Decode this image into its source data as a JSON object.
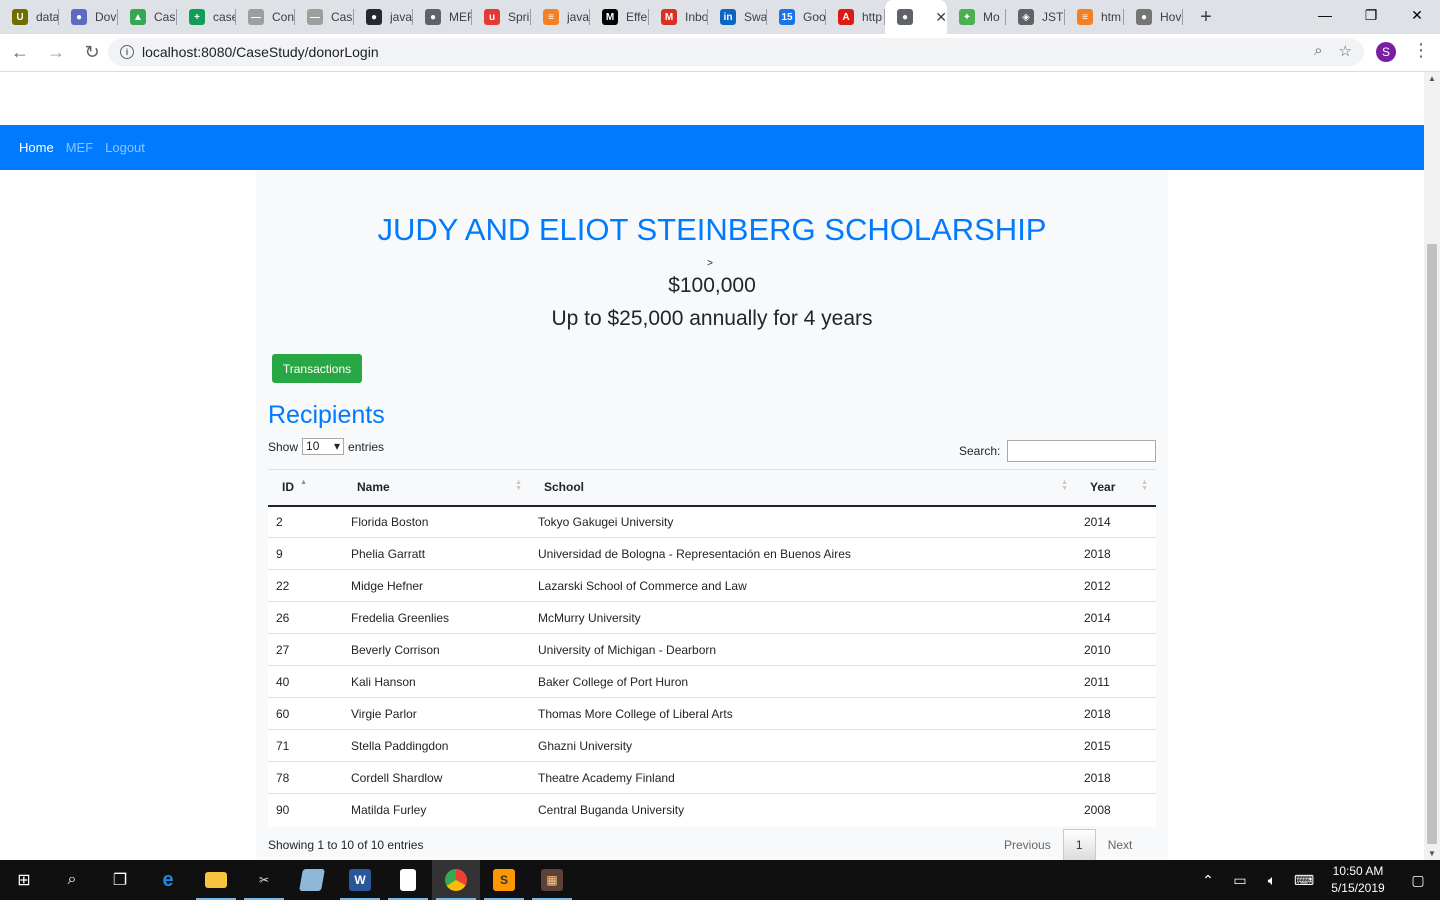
{
  "browser": {
    "tabs": [
      {
        "title": "data",
        "color": "#6d6d00",
        "glyph": "U"
      },
      {
        "title": "Dov",
        "color": "#5c6bc0",
        "glyph": "●"
      },
      {
        "title": "Cas",
        "color": "#34a853",
        "glyph": "▲"
      },
      {
        "title": "case",
        "color": "#0f9d58",
        "glyph": "+"
      },
      {
        "title": "Con",
        "color": "#9e9e9e",
        "glyph": "—"
      },
      {
        "title": "Cas",
        "color": "#9e9e9e",
        "glyph": "—"
      },
      {
        "title": "java",
        "color": "#24292e",
        "glyph": "●"
      },
      {
        "title": "MEF",
        "color": "#5f6368",
        "glyph": "●"
      },
      {
        "title": "Spri",
        "color": "#e53935",
        "glyph": "u"
      },
      {
        "title": "java",
        "color": "#f48024",
        "glyph": "≡"
      },
      {
        "title": "Effe",
        "color": "#000000",
        "glyph": "M"
      },
      {
        "title": "Inbo",
        "color": "#d93025",
        "glyph": "M"
      },
      {
        "title": "Swa",
        "color": "#0a66c2",
        "glyph": "in"
      },
      {
        "title": "Goo",
        "color": "#1a73e8",
        "glyph": "15"
      },
      {
        "title": "http",
        "color": "#dd1b16",
        "glyph": "A"
      }
    ],
    "active_tab": {
      "title": "",
      "color": "#5f6368",
      "glyph": "●"
    },
    "tabs_after": [
      {
        "title": "Mo",
        "color": "#4caf50",
        "glyph": "✦"
      },
      {
        "title": "JSTL",
        "color": "#5f6368",
        "glyph": "◈"
      },
      {
        "title": "htm",
        "color": "#f48024",
        "glyph": "≡"
      },
      {
        "title": "Hov",
        "color": "#757575",
        "glyph": "●"
      }
    ],
    "url": "localhost:8080/CaseStudy/donorLogin",
    "profile_initial": "S"
  },
  "navbar": {
    "home": "Home",
    "mef": "MEF",
    "logout": "Logout"
  },
  "page": {
    "title": "JUDY AND ELIOT STEINBERG SCHOLARSHIP",
    "caret": ">",
    "amount": "$100,000",
    "subtitle": "Up to $25,000 annually for 4 years",
    "transactions_button": "Transactions",
    "section_title": "Recipients",
    "show_label": "Show",
    "show_value": "10",
    "entries_label": "entries",
    "search_label": "Search:",
    "search_value": ""
  },
  "table": {
    "columns": [
      "ID",
      "Name",
      "School",
      "Year"
    ],
    "rows": [
      [
        "2",
        "Florida Boston",
        "Tokyo Gakugei University",
        "2014"
      ],
      [
        "9",
        "Phelia Garratt",
        "Universidad de Bologna - Representación en Buenos Aires",
        "2018"
      ],
      [
        "22",
        "Midge Hefner",
        "Lazarski School of Commerce and Law",
        "2012"
      ],
      [
        "26",
        "Fredelia Greenlies",
        "McMurry University",
        "2014"
      ],
      [
        "27",
        "Beverly Corrison",
        "University of Michigan - Dearborn",
        "2010"
      ],
      [
        "40",
        "Kali Hanson",
        "Baker College of Port Huron",
        "2011"
      ],
      [
        "60",
        "Virgie Parlor",
        "Thomas More College of Liberal Arts",
        "2018"
      ],
      [
        "71",
        "Stella Paddingdon",
        "Ghazni University",
        "2015"
      ],
      [
        "78",
        "Cordell Shardlow",
        "Theatre Academy Finland",
        "2018"
      ],
      [
        "90",
        "Matilda Furley",
        "Central Buganda University",
        "2008"
      ]
    ]
  },
  "footer": {
    "info": "Showing 1 to 10 of 10 entries",
    "previous": "Previous",
    "current_page": "1",
    "next": "Next"
  },
  "taskbar": {
    "time": "10:50 AM",
    "date": "5/15/2019"
  }
}
